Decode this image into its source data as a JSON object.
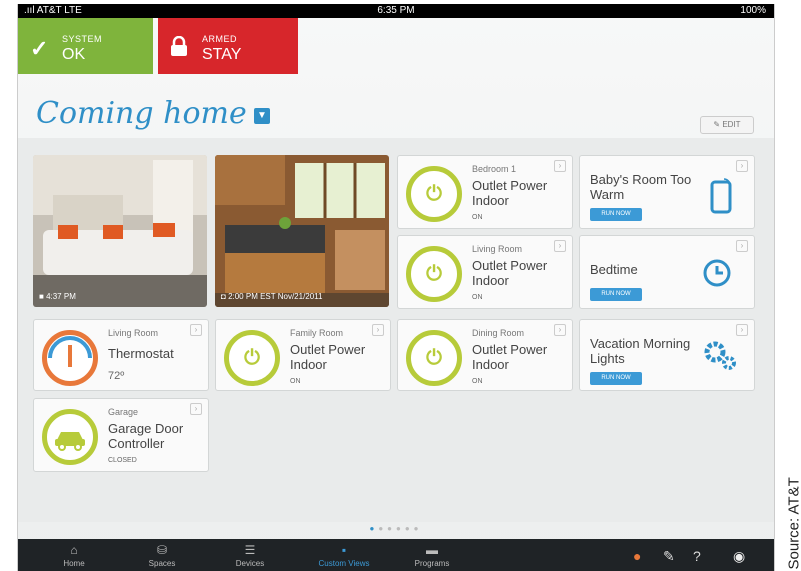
{
  "status_bar": {
    "carrier": ".ııl AT&T  LTE",
    "time": "6:35 PM",
    "battery": "100%"
  },
  "system_tile": {
    "label": "SYSTEM",
    "value": "OK",
    "color": "#7fb43c"
  },
  "armed_tile": {
    "label": "ARMED",
    "value": "STAY",
    "color": "#d7262b"
  },
  "page": {
    "title": "Coming home",
    "edit_label": "EDIT"
  },
  "cameras": [
    {
      "timestamp": "4:37 PM"
    },
    {
      "timestamp": "2:00 PM EST Nov/21/2011"
    }
  ],
  "devices": {
    "bedroom_outlet": {
      "room": "Bedroom 1",
      "name": "Outlet Power Indoor",
      "state": "ON"
    },
    "living_outlet": {
      "room": "Living Room",
      "name": "Outlet Power Indoor",
      "state": "ON"
    },
    "thermostat": {
      "room": "Living Room",
      "name": "Thermostat",
      "temp": "72º"
    },
    "family_outlet": {
      "room": "Family Room",
      "name": "Outlet Power Indoor",
      "state": "ON"
    },
    "dining_outlet": {
      "room": "Dining Room",
      "name": "Outlet Power Indoor",
      "state": "ON"
    },
    "garage": {
      "room": "Garage",
      "name": "Garage Door Controller",
      "state": "CLOSED"
    }
  },
  "programs": {
    "babys_room": {
      "name": "Baby's Room Too Warm",
      "run": "RUN NOW"
    },
    "bedtime": {
      "name": "Bedtime",
      "run": "RUN NOW"
    },
    "vacation": {
      "name": "Vacation Morning Lights",
      "run": "RUN NOW"
    }
  },
  "tabs": [
    "Home",
    "Spaces",
    "Devices",
    "Custom Views",
    "Programs"
  ],
  "active_tab": "Custom Views",
  "accent_color": "#3c9ad6",
  "source_credit": "Source: AT&T"
}
